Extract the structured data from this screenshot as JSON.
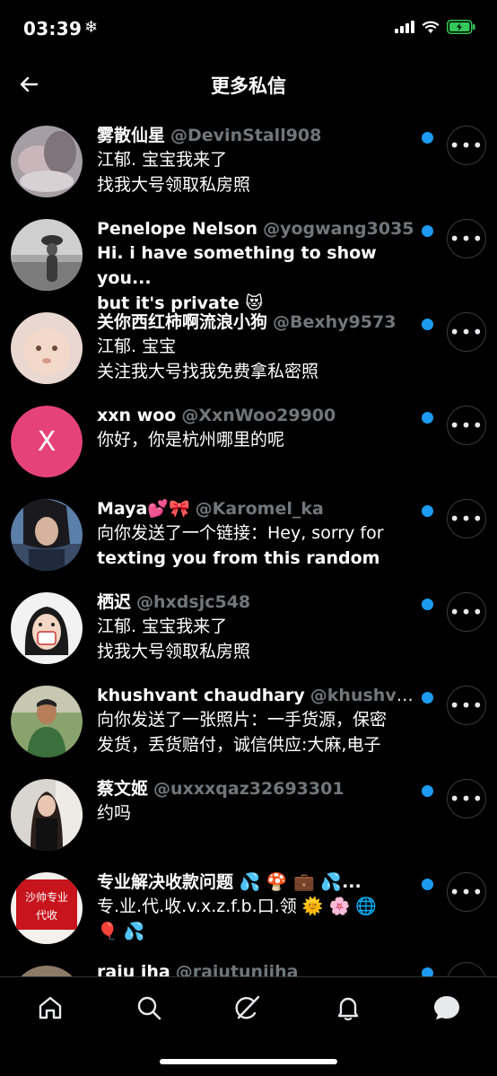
{
  "status_bar": {
    "time": "03:39"
  },
  "header": {
    "title": "更多私信"
  },
  "conversations": [
    {
      "name": "雾散仙星",
      "handle": "@DevinStall908",
      "lines": [
        "江郁. 宝宝我来了",
        "找我大号领取私房照"
      ],
      "bold": false,
      "avatar": "photo"
    },
    {
      "name": "Penelope Nelson",
      "handle": "@yogwang3035",
      "lines": [
        "Hi. i have something to show you...",
        "but it's private 😻"
      ],
      "bold": true,
      "avatar": "photo"
    },
    {
      "name": "关你西红柿啊流浪小狗",
      "handle": "@Bexhy9573",
      "lines": [
        "江郁. 宝宝",
        "关注我大号找我免费拿私密照"
      ],
      "bold": false,
      "avatar": "photo"
    },
    {
      "name": "xxn woo",
      "handle": "@XxnWoo29900",
      "lines": [
        "你好，你是杭州哪里的呢"
      ],
      "bold": false,
      "avatar": "letter",
      "avatar_letter": "X"
    },
    {
      "name": "Maya💕🎀",
      "handle": "@Karomel_ka",
      "lines": [
        "向你发送了一个链接：Hey, sorry for",
        "texting you from this random"
      ],
      "bold": true,
      "avatar": "photo"
    },
    {
      "name": "栖迟",
      "handle": "@hxdsjc548",
      "lines": [
        "江郁. 宝宝我来了",
        "找我大号领取私房照"
      ],
      "bold": false,
      "avatar": "photo"
    },
    {
      "name": "khushvant chaudhary",
      "handle": "@khushvant",
      "lines": [
        "向你发送了一张照片：一手货源，保密",
        "发货，丢货赔付，诚信供应:大麻,电子"
      ],
      "bold": false,
      "avatar": "photo"
    },
    {
      "name": "蔡文姬",
      "handle": "@uxxxqaz32693301",
      "lines": [
        "约吗"
      ],
      "bold": false,
      "avatar": "photo"
    },
    {
      "name": "专业解决收款问题 💦 🍄 💼 💦...",
      "handle": "",
      "lines": [
        "专.业.代.收.v.x.z.f.b.口.领 🌞 🌸 🌐",
        "🎈 💦"
      ],
      "bold": false,
      "avatar": "photo",
      "avatar_text": "沙帅专业代收"
    },
    {
      "name": "raju jha",
      "handle": "@rajutunjiha",
      "lines": [
        ""
      ],
      "bold": false,
      "avatar": "photo"
    }
  ],
  "more_label": "•••",
  "tabs": [
    "home",
    "search",
    "grok",
    "notifications",
    "messages"
  ]
}
